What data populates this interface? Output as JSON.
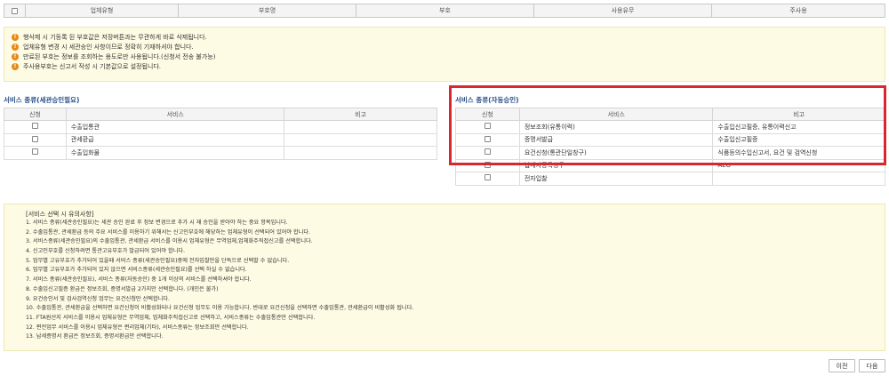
{
  "top_table": {
    "columns": [
      "업체유형",
      "부호명",
      "부호",
      "사용유무",
      "주사용"
    ]
  },
  "notices": [
    "행삭제 시 기등록 된 부호값은 저장버튼과는 무관하게 바로 삭제됩니다.",
    "업체유형 변경 시 세관승인 사항이므로 정확히 기재하셔야 합니다.",
    "만료된 부호는 정보를 조회하는 용도로만 사용됩니다.(신청서 전송 불가능)",
    "주사용부호는 신고서 작성 시 기본값으로 설정됩니다."
  ],
  "left_section": {
    "title": "서비스 종류(세관승인필요)",
    "headers": [
      "신청",
      "서비스",
      "비고"
    ],
    "rows": [
      {
        "service": "수출입통관",
        "note": ""
      },
      {
        "service": "관세환급",
        "note": ""
      },
      {
        "service": "수출입화물",
        "note": ""
      }
    ]
  },
  "right_section": {
    "title": "서비스 종류(자동승인)",
    "headers": [
      "신청",
      "서비스",
      "비고"
    ],
    "rows": [
      {
        "service": "정보조회(유통이력)",
        "note": "수출입신고필증, 유통이력신고"
      },
      {
        "service": "증명서발급",
        "note": "수출입신고필증"
      },
      {
        "service": "요건신청(통관단일창구)",
        "note": "식품등의수입신고서, 요건 및 검역신청"
      },
      {
        "service": "납세자증목청구",
        "note": "AEO"
      },
      {
        "service": "전자입찰",
        "note": ""
      }
    ]
  },
  "guide": {
    "title": "[서비스 선택 시 유의사항]",
    "items": [
      "1. 서비스 종류(세관승인필요)는 세관 승인 완료 후 정보 변경으로 추가 시 재 승인을 받아야 하는 중요 항목입니다.",
      "2. 수출입통관, 관세환급 등의 주요 서비스를 이용하기 위해서는 신고인부호에 해당하는 업체유형이 선택되어 있어야 합니다.",
      "3. 서비스종류(세관승인필요)의 수출입통관, 관세환급 서비스를 이용시 업체유형은 무역업체,업체화주직접신고를 선택합니다.",
      "4. 신고인부호를 신청하려면 통관고유부호가 발급되어 있어야 합니다.",
      "5. 업무별 고유부호가 추가되어 있을때 서비스 종류(세관승인필요)중에 전자입찰만을 단독으로 선택할 수 없습니다.",
      "6. 업무별 고유부호가 추가되어 있지 않으면 서비스종류(세관승인필요)를 선택 하실 수 없습니다.",
      "7. 서비스 종류(세관승인필요), 서비스 종류(자동승인) 중 1개 이상의 서비스를 선택하셔야 합니다.",
      "8. 수출입신고필증 환급은 정보조회, 증명서발급 2가지만 선택합니다. (개인은 불가)",
      "9. 요건승인서 및 검사검역신청 업무는 요건신청만 선택합니다.",
      "10. 수출입통관, 관세환급을 선택하면 요건신청이 비활성화되나 요건신청 업무도 이용 가능합니다. 반대로 요건신청을 선택하면 수출입통관, 관세환급이 비활성화 됩니다.",
      "11. FTA원산지 서비스를 이용시 업체유형은 무역업체, 업체화주직접신고로 선택하고, 서비스종류는 수출입통관만 선택합니다.",
      "12. 편전업무 서비스를 이용시 업체유형은 편리업체(기타), 서비스종류는 정보조회만 선택합니다.",
      "13. 납세증명서 환급은 정보조회, 증명서환급만 선택합니다."
    ]
  },
  "buttons": {
    "prev": "이전",
    "next": "다음"
  },
  "colors": {
    "highlight": "#d9272e",
    "section_title": "#2a4f8a",
    "notice_bg": "#fdfbe3",
    "warning_icon": "#e58a1a"
  }
}
